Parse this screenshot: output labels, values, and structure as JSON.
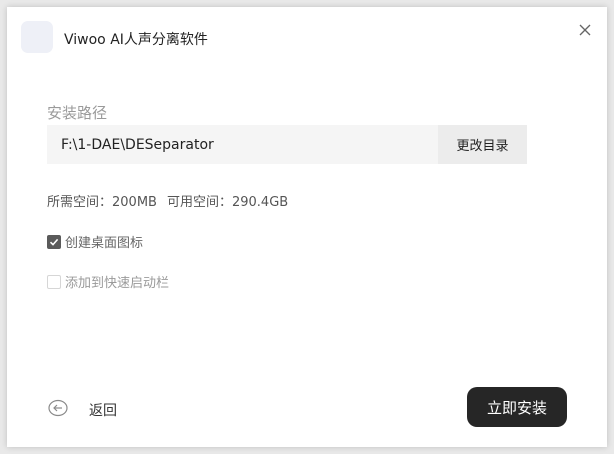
{
  "app": {
    "title": "Viwoo AI人声分离软件",
    "logo_icon": "waveform-icon",
    "close_icon": "close-icon"
  },
  "install_path": {
    "label": "安装路径",
    "value": "F:\\1-DAE\\DESeparator",
    "change_button_label": "更改目录"
  },
  "space": {
    "required_label": "所需空间：",
    "required_value": "200MB",
    "available_label": "可用空间：",
    "available_value": "290.4GB"
  },
  "options": [
    {
      "label": "创建桌面图标",
      "checked": true
    },
    {
      "label": "添加到快速启动栏",
      "checked": false
    }
  ],
  "footer": {
    "back_icon": "back-arrow-icon",
    "back_label": "返回",
    "install_label": "立即安装"
  },
  "colors": {
    "primary_button": "#262626",
    "path_background": "#f5f5f5",
    "logo_gradient_start": "#7b3cff",
    "logo_gradient_end": "#ff3d8a"
  }
}
